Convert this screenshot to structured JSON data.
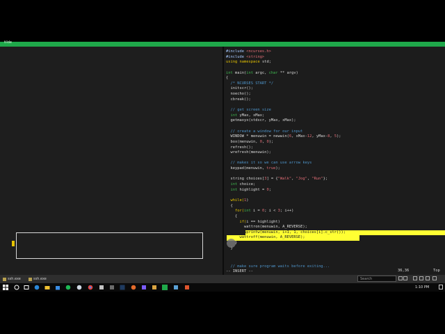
{
  "window": {
    "title": "tilde"
  },
  "editor": {
    "lines": [
      [
        {
          "t": "#include ",
          "c": "#a5c8ff"
        },
        {
          "t": "<ncurses.h>",
          "c": "#e06c75"
        }
      ],
      [
        {
          "t": "#include ",
          "c": "#a5c8ff"
        },
        {
          "t": "<string>",
          "c": "#e06c75"
        }
      ],
      [
        {
          "t": "using ",
          "c": "#e6c300"
        },
        {
          "t": "namespace ",
          "c": "#e6c300"
        },
        {
          "t": "std;",
          "c": "#d8d8d8"
        }
      ],
      [
        {
          "t": "",
          "c": "#d8d8d8"
        }
      ],
      [
        {
          "t": "int ",
          "c": "#3fb950"
        },
        {
          "t": "main(",
          "c": "#d8d8d8"
        },
        {
          "t": "int ",
          "c": "#3fb950"
        },
        {
          "t": "argc, ",
          "c": "#d8d8d8"
        },
        {
          "t": "char ",
          "c": "#3fb950"
        },
        {
          "t": "** argv)",
          "c": "#d8d8d8"
        }
      ],
      [
        {
          "t": "{",
          "c": "#d8d8d8"
        }
      ],
      [
        {
          "t": "  /* NCURSES START */",
          "c": "#4e93c8"
        }
      ],
      [
        {
          "t": "  initscr();",
          "c": "#d8d8d8"
        }
      ],
      [
        {
          "t": "  noecho();",
          "c": "#d8d8d8"
        }
      ],
      [
        {
          "t": "  cbreak();",
          "c": "#d8d8d8"
        }
      ],
      [
        {
          "t": "",
          "c": "#d8d8d8"
        }
      ],
      [
        {
          "t": "  // get screen size",
          "c": "#4e93c8"
        }
      ],
      [
        {
          "t": "  int ",
          "c": "#3fb950"
        },
        {
          "t": "yMax, xMax;",
          "c": "#d8d8d8"
        }
      ],
      [
        {
          "t": "  getmaxyx(stdscr, yMax, xMax);",
          "c": "#d8d8d8"
        }
      ],
      [
        {
          "t": "",
          "c": "#d8d8d8"
        }
      ],
      [
        {
          "t": "  // create a window for our input",
          "c": "#4e93c8"
        }
      ],
      [
        {
          "t": "  WINDOW * menuwin = newwin(",
          "c": "#d8d8d8"
        },
        {
          "t": "6",
          "c": "#e06c75"
        },
        {
          "t": ", xMax-",
          "c": "#d8d8d8"
        },
        {
          "t": "12",
          "c": "#e06c75"
        },
        {
          "t": ", yMax-",
          "c": "#d8d8d8"
        },
        {
          "t": "8",
          "c": "#e06c75"
        },
        {
          "t": ", ",
          "c": "#d8d8d8"
        },
        {
          "t": "5",
          "c": "#e06c75"
        },
        {
          "t": ");",
          "c": "#d8d8d8"
        }
      ],
      [
        {
          "t": "  box(menuwin, ",
          "c": "#d8d8d8"
        },
        {
          "t": "0",
          "c": "#e06c75"
        },
        {
          "t": ", ",
          "c": "#d8d8d8"
        },
        {
          "t": "0",
          "c": "#e06c75"
        },
        {
          "t": ");",
          "c": "#d8d8d8"
        }
      ],
      [
        {
          "t": "  refresh();",
          "c": "#d8d8d8"
        }
      ],
      [
        {
          "t": "  wrefresh(menuwin);",
          "c": "#d8d8d8"
        }
      ],
      [
        {
          "t": "",
          "c": "#d8d8d8"
        }
      ],
      [
        {
          "t": "  // makes it so we can use arrow keys",
          "c": "#4e93c8"
        }
      ],
      [
        {
          "t": "  keypad(menuwin, ",
          "c": "#d8d8d8"
        },
        {
          "t": "true",
          "c": "#e06c75"
        },
        {
          "t": ");",
          "c": "#d8d8d8"
        }
      ],
      [
        {
          "t": "",
          "c": "#d8d8d8"
        }
      ],
      [
        {
          "t": "  string choices[",
          "c": "#d8d8d8"
        },
        {
          "t": "3",
          "c": "#e06c75"
        },
        {
          "t": "] = {",
          "c": "#d8d8d8"
        },
        {
          "t": "\"Walk\"",
          "c": "#e06c75"
        },
        {
          "t": ", ",
          "c": "#d8d8d8"
        },
        {
          "t": "\"Jog\"",
          "c": "#e06c75"
        },
        {
          "t": ", ",
          "c": "#d8d8d8"
        },
        {
          "t": "\"Run\"",
          "c": "#e06c75"
        },
        {
          "t": "};",
          "c": "#d8d8d8"
        }
      ],
      [
        {
          "t": "  int ",
          "c": "#3fb950"
        },
        {
          "t": "choice;",
          "c": "#d8d8d8"
        }
      ],
      [
        {
          "t": "  int ",
          "c": "#3fb950"
        },
        {
          "t": "highlight = ",
          "c": "#d8d8d8"
        },
        {
          "t": "0",
          "c": "#e06c75"
        },
        {
          "t": ";",
          "c": "#d8d8d8"
        }
      ],
      [
        {
          "t": "",
          "c": "#d8d8d8"
        }
      ],
      [
        {
          "t": "  while(",
          "c": "#e6c300"
        },
        {
          "t": "1",
          "c": "#e06c75"
        },
        {
          "t": ")",
          "c": "#d8d8d8"
        }
      ],
      [
        {
          "t": "  {",
          "c": "#d8d8d8"
        }
      ],
      [
        {
          "t": "    for(",
          "c": "#e6c300"
        },
        {
          "t": "int ",
          "c": "#3fb950"
        },
        {
          "t": "i = ",
          "c": "#d8d8d8"
        },
        {
          "t": "0",
          "c": "#e06c75"
        },
        {
          "t": "; i < ",
          "c": "#d8d8d8"
        },
        {
          "t": "3",
          "c": "#e06c75"
        },
        {
          "t": "; i++)",
          "c": "#d8d8d8"
        }
      ],
      [
        {
          "t": "    {",
          "c": "#d8d8d8"
        }
      ],
      [
        {
          "t": "      if(",
          "c": "#e6c300"
        },
        {
          "t": "i == highlight)",
          "c": "#d8d8d8"
        }
      ],
      [
        {
          "t": "        wattron(menuwin, A_REVERSE);",
          "c": "#d8d8d8"
        }
      ],
      [
        {
          "t": "      mvwprintw(menuwin, i+1, 1, choices[i].c_str());",
          "c": "#202020"
        }
      ],
      [
        {
          "t": "      wattroff(menuwin, A_REVERSE);",
          "c": "#202020"
        }
      ],
      [
        {
          "t": "    }",
          "c": "#d8d8d8"
        }
      ],
      [
        {
          "t": "  }",
          "c": "#d8d8d8"
        }
      ]
    ],
    "status_comment": "  // make sure program waits before exiting...",
    "mode": "-- INSERT --",
    "position": "36,36",
    "scroll": "Top"
  },
  "taskbar_buttons": [
    {
      "label": "ssh.exe"
    },
    {
      "label": "ssh.exe"
    }
  ],
  "search": {
    "placeholder": "Search"
  },
  "clock": "1:10 PM",
  "colors": {
    "accent": "#1fa84a",
    "highlight": "#ffff33"
  }
}
